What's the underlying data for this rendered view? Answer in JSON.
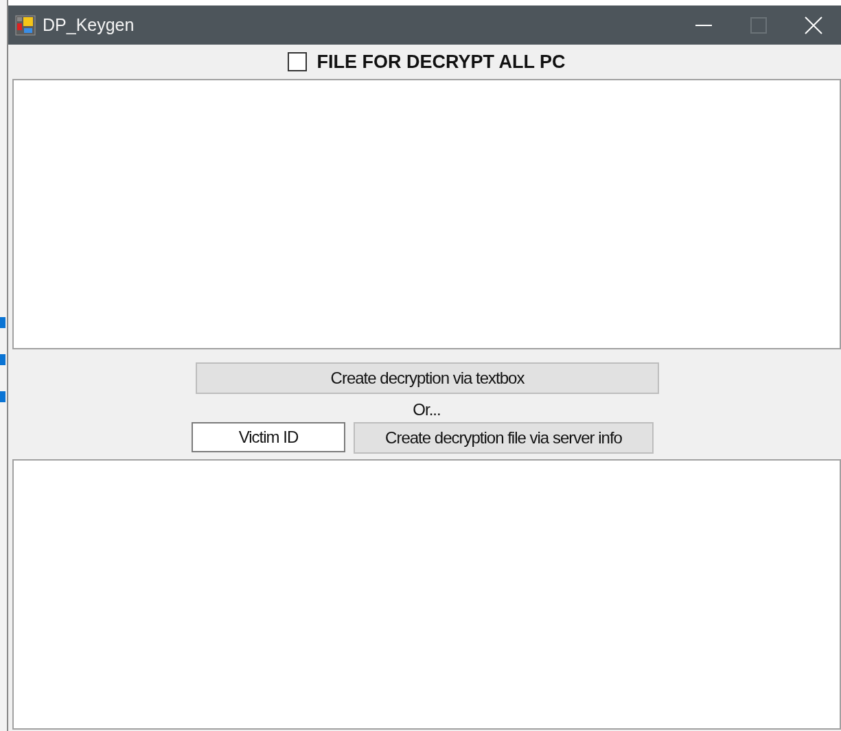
{
  "window": {
    "title": "DP_Keygen"
  },
  "checkbox": {
    "label": "FILE FOR DECRYPT ALL PC",
    "checked": false
  },
  "buttons": [
    {
      "label": "Create decryption via textbox"
    },
    {
      "label": "Create decryption file via server info"
    }
  ],
  "separator_text": "Or...",
  "victim_id_field": {
    "value": "Victim ID"
  }
}
